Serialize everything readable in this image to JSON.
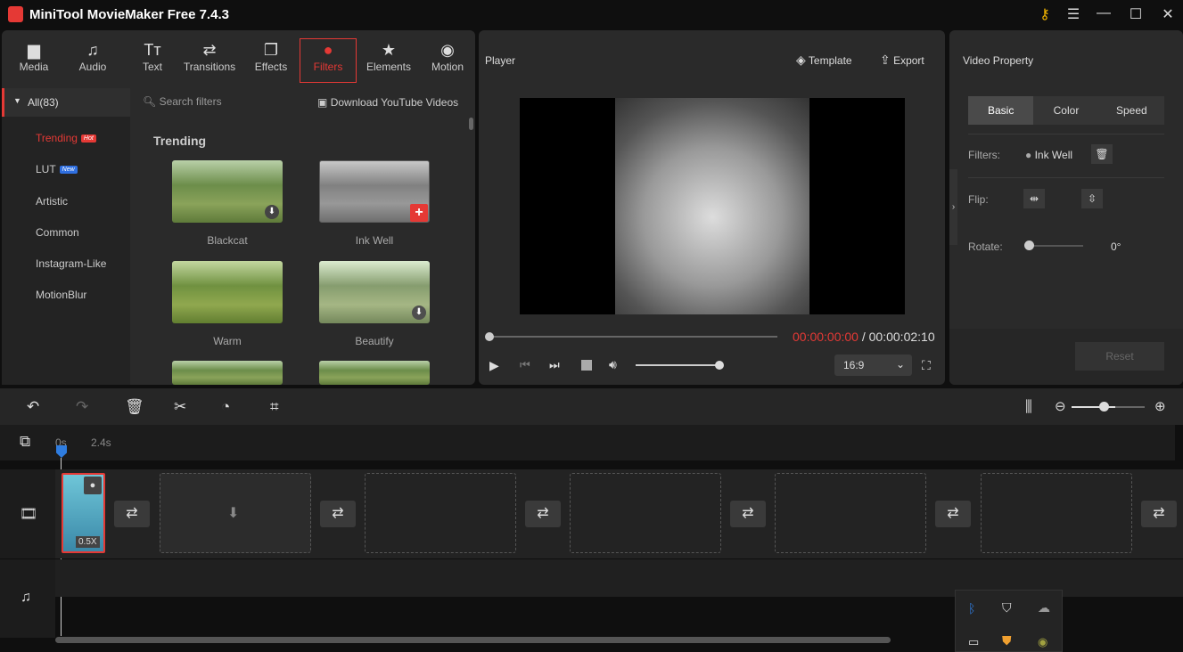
{
  "app": {
    "title": "MiniTool MovieMaker Free 7.4.3"
  },
  "window": {
    "key_icon": "key-icon",
    "menu_icon": "☰",
    "min": "—",
    "max": "☐",
    "close": "✕"
  },
  "tabs": [
    {
      "label": "Media",
      "icon": "folder-icon"
    },
    {
      "label": "Audio",
      "icon": "music-icon"
    },
    {
      "label": "Text",
      "icon": "text-icon"
    },
    {
      "label": "Transitions",
      "icon": "transition-icon"
    },
    {
      "label": "Effects",
      "icon": "effects-icon"
    },
    {
      "label": "Filters",
      "icon": "filters-icon",
      "active": true
    },
    {
      "label": "Elements",
      "icon": "elements-icon"
    },
    {
      "label": "Motion",
      "icon": "motion-icon"
    }
  ],
  "library": {
    "all": "All(83)",
    "search_placeholder": "Search filters",
    "download_youtube": "Download YouTube Videos",
    "categories": [
      {
        "label": "Trending",
        "badge": "Hot",
        "active": true
      },
      {
        "label": "LUT",
        "badge": "New"
      },
      {
        "label": "Artistic"
      },
      {
        "label": "Common"
      },
      {
        "label": "Instagram-Like"
      },
      {
        "label": "MotionBlur"
      }
    ],
    "section_title": "Trending",
    "filters": [
      {
        "label": "Blackcat",
        "state": "download"
      },
      {
        "label": "Ink Well",
        "state": "add",
        "selected": true
      },
      {
        "label": "Warm"
      },
      {
        "label": "Beautify",
        "state": "download"
      }
    ]
  },
  "player": {
    "title": "Player",
    "template": "Template",
    "export": "Export",
    "current_time": "00:00:00:00",
    "separator": "/",
    "total_time": "00:00:02:10",
    "aspect": "16:9",
    "progress": 0,
    "volume": 1
  },
  "property": {
    "title": "Video Property",
    "tabs": [
      "Basic",
      "Color",
      "Speed"
    ],
    "active_tab": "Basic",
    "filters_label": "Filters:",
    "filter_value": "Ink Well",
    "flip_label": "Flip:",
    "rotate_label": "Rotate:",
    "rotate_value": "0°",
    "rotate": 0,
    "reset": "Reset"
  },
  "timeline": {
    "ruler": [
      "0s",
      "2.4s"
    ],
    "clip_speed": "0.5X",
    "zoom": 0.6
  },
  "colors": {
    "accent": "#e53935",
    "panel": "#2a2a2a",
    "bg": "#0f0f0f"
  }
}
